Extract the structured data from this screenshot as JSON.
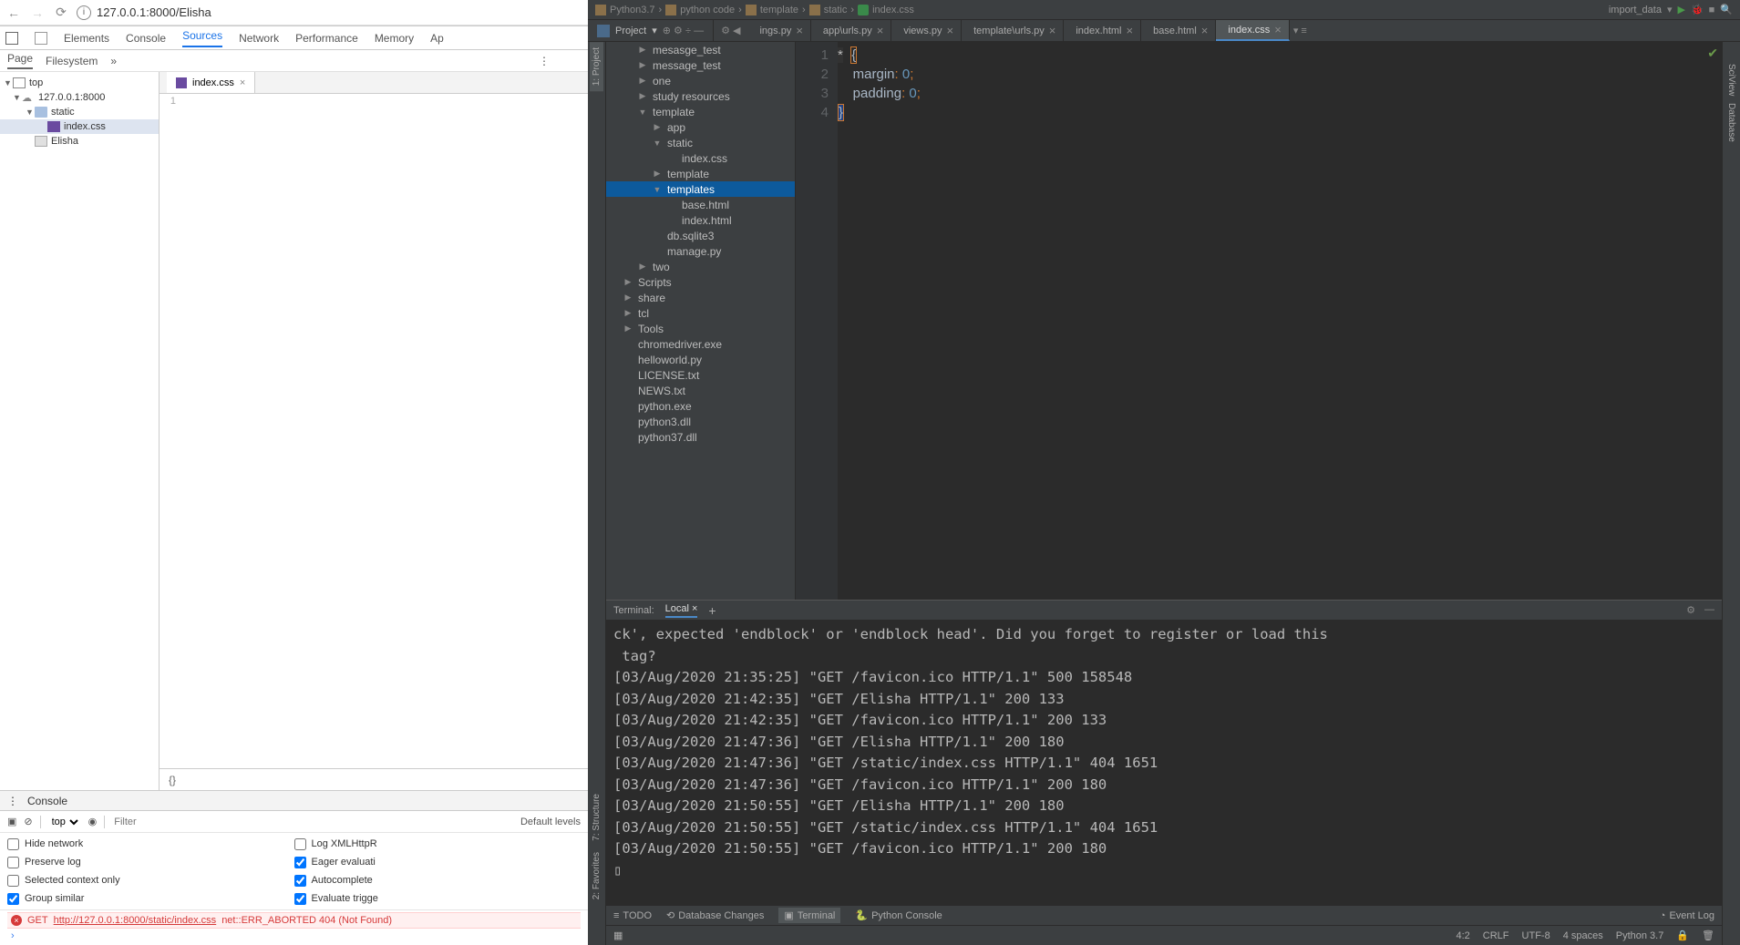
{
  "chrome": {
    "url": "127.0.0.1:8000/Elisha",
    "devtools": {
      "tabs": [
        "Elements",
        "Console",
        "Sources",
        "Network",
        "Performance",
        "Memory",
        "Ap"
      ],
      "active_tab": "Sources",
      "subtabs": [
        "Page",
        "Filesystem"
      ],
      "active_subtab": "Page",
      "tree": {
        "top": "top",
        "origin": "127.0.0.1:8000",
        "static_folder": "static",
        "css_file": "index.css",
        "page_file": "Elisha"
      },
      "editor_tab": "index.css",
      "gutter_start": "1",
      "braces": "{}",
      "console": {
        "title": "Console",
        "context": "top",
        "filter_placeholder": "Filter",
        "level": "Default levels",
        "checks": {
          "hide_network": "Hide network",
          "hide_network_v": false,
          "log_xhr": "Log XMLHttpR",
          "log_xhr_v": false,
          "preserve": "Preserve log",
          "preserve_v": false,
          "eager": "Eager evaluati",
          "eager_v": true,
          "context_only": "Selected context only",
          "context_only_v": false,
          "auto": "Autocomplete",
          "auto_v": true,
          "group": "Group similar",
          "group_v": true,
          "evalt": "Evaluate trigge",
          "evalt_v": true
        },
        "err_method": "GET",
        "err_url": "http://127.0.0.1:8000/static/index.css",
        "err_tail": "net::ERR_ABORTED 404 (Not Found)"
      }
    }
  },
  "pycharm": {
    "breadcrumbs": [
      "Python3.7",
      "python code",
      "template",
      "static",
      "index.css"
    ],
    "run_label": "import_data",
    "project_label": "Project",
    "editor_tabs": [
      {
        "name": "ings.py",
        "type": "py",
        "active": false
      },
      {
        "name": "app\\urls.py",
        "type": "py",
        "active": false
      },
      {
        "name": "views.py",
        "type": "py",
        "active": false
      },
      {
        "name": "template\\urls.py",
        "type": "py",
        "active": false
      },
      {
        "name": "index.html",
        "type": "html",
        "active": false
      },
      {
        "name": "base.html",
        "type": "html",
        "active": false
      },
      {
        "name": "index.css",
        "type": "css",
        "active": true
      }
    ],
    "tree": [
      {
        "d": 1,
        "a": "▶",
        "t": "dir",
        "n": "mesasge_test"
      },
      {
        "d": 1,
        "a": "▶",
        "t": "dir",
        "n": "message_test"
      },
      {
        "d": 1,
        "a": "▶",
        "t": "dir",
        "n": "one"
      },
      {
        "d": 1,
        "a": "▶",
        "t": "dir",
        "n": "study resources"
      },
      {
        "d": 1,
        "a": "▼",
        "t": "dir",
        "n": "template"
      },
      {
        "d": 2,
        "a": "▶",
        "t": "dir",
        "n": "app"
      },
      {
        "d": 2,
        "a": "▼",
        "t": "dir",
        "n": "static"
      },
      {
        "d": 3,
        "a": "",
        "t": "css",
        "n": "index.css"
      },
      {
        "d": 2,
        "a": "▶",
        "t": "dir",
        "n": "template"
      },
      {
        "d": 2,
        "a": "▼",
        "t": "dir",
        "n": "templates",
        "sel": true
      },
      {
        "d": 3,
        "a": "",
        "t": "html",
        "n": "base.html"
      },
      {
        "d": 3,
        "a": "",
        "t": "html",
        "n": "index.html"
      },
      {
        "d": 2,
        "a": "",
        "t": "db",
        "n": "db.sqlite3"
      },
      {
        "d": 2,
        "a": "",
        "t": "py",
        "n": "manage.py"
      },
      {
        "d": 1,
        "a": "▶",
        "t": "dir",
        "n": "two"
      },
      {
        "d": 0,
        "a": "▶",
        "t": "dir",
        "n": "Scripts"
      },
      {
        "d": 0,
        "a": "▶",
        "t": "dir",
        "n": "share"
      },
      {
        "d": 0,
        "a": "▶",
        "t": "dir",
        "n": "tcl"
      },
      {
        "d": 0,
        "a": "▶",
        "t": "dir",
        "n": "Tools"
      },
      {
        "d": 0,
        "a": "",
        "t": "py",
        "n": "chromedriver.exe"
      },
      {
        "d": 0,
        "a": "",
        "t": "py",
        "n": "helloworld.py"
      },
      {
        "d": 0,
        "a": "",
        "t": "txt",
        "n": "LICENSE.txt"
      },
      {
        "d": 0,
        "a": "",
        "t": "txt",
        "n": "NEWS.txt"
      },
      {
        "d": 0,
        "a": "",
        "t": "py",
        "n": "python.exe"
      },
      {
        "d": 0,
        "a": "",
        "t": "py",
        "n": "python3.dll"
      },
      {
        "d": 0,
        "a": "",
        "t": "py",
        "n": "python37.dll"
      }
    ],
    "code": {
      "l1": "* {",
      "l2": "    margin: 0;",
      "l3": "    padding: 0;",
      "l4": "}"
    },
    "terminal": {
      "label": "Terminal:",
      "tab": "Local",
      "lines": [
        "ck', expected 'endblock' or 'endblock head'. Did you forget to register or load this",
        " tag?",
        "[03/Aug/2020 21:35:25] \"GET /favicon.ico HTTP/1.1\" 500 158548",
        "[03/Aug/2020 21:42:35] \"GET /Elisha HTTP/1.1\" 200 133",
        "[03/Aug/2020 21:42:35] \"GET /favicon.ico HTTP/1.1\" 200 133",
        "[03/Aug/2020 21:47:36] \"GET /Elisha HTTP/1.1\" 200 180",
        "[03/Aug/2020 21:47:36] \"GET /static/index.css HTTP/1.1\" 404 1651",
        "[03/Aug/2020 21:47:36] \"GET /favicon.ico HTTP/1.1\" 200 180",
        "[03/Aug/2020 21:50:55] \"GET /Elisha HTTP/1.1\" 200 180",
        "[03/Aug/2020 21:50:55] \"GET /static/index.css HTTP/1.1\" 404 1651",
        "[03/Aug/2020 21:50:55] \"GET /favicon.ico HTTP/1.1\" 200 180",
        "▯"
      ]
    },
    "status_tools": {
      "todo": "TODO",
      "db": "Database Changes",
      "term": "Terminal",
      "pycon": "Python Console",
      "evlog": "Event Log"
    },
    "status_right": {
      "pos": "4:2",
      "le": "CRLF",
      "enc": "UTF-8",
      "indent": "4 spaces",
      "interp": "Python 3.7"
    },
    "side": {
      "project": "1: Project",
      "structure": "7: Structure",
      "fav": "2: Favorites",
      "sciview": "SciView",
      "database": "Database"
    }
  }
}
